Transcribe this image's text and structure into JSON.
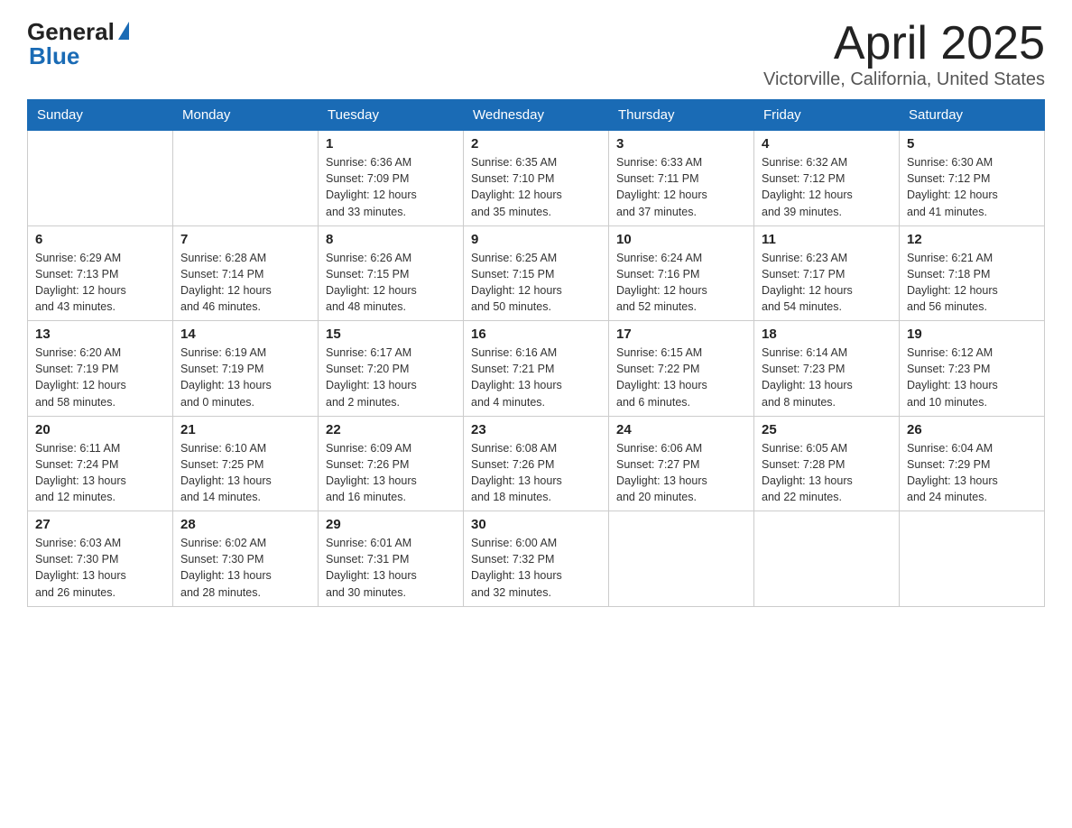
{
  "header": {
    "logo_general": "General",
    "logo_blue": "Blue",
    "title": "April 2025",
    "subtitle": "Victorville, California, United States"
  },
  "weekdays": [
    "Sunday",
    "Monday",
    "Tuesday",
    "Wednesday",
    "Thursday",
    "Friday",
    "Saturday"
  ],
  "weeks": [
    [
      {
        "day": "",
        "info": ""
      },
      {
        "day": "",
        "info": ""
      },
      {
        "day": "1",
        "info": "Sunrise: 6:36 AM\nSunset: 7:09 PM\nDaylight: 12 hours\nand 33 minutes."
      },
      {
        "day": "2",
        "info": "Sunrise: 6:35 AM\nSunset: 7:10 PM\nDaylight: 12 hours\nand 35 minutes."
      },
      {
        "day": "3",
        "info": "Sunrise: 6:33 AM\nSunset: 7:11 PM\nDaylight: 12 hours\nand 37 minutes."
      },
      {
        "day": "4",
        "info": "Sunrise: 6:32 AM\nSunset: 7:12 PM\nDaylight: 12 hours\nand 39 minutes."
      },
      {
        "day": "5",
        "info": "Sunrise: 6:30 AM\nSunset: 7:12 PM\nDaylight: 12 hours\nand 41 minutes."
      }
    ],
    [
      {
        "day": "6",
        "info": "Sunrise: 6:29 AM\nSunset: 7:13 PM\nDaylight: 12 hours\nand 43 minutes."
      },
      {
        "day": "7",
        "info": "Sunrise: 6:28 AM\nSunset: 7:14 PM\nDaylight: 12 hours\nand 46 minutes."
      },
      {
        "day": "8",
        "info": "Sunrise: 6:26 AM\nSunset: 7:15 PM\nDaylight: 12 hours\nand 48 minutes."
      },
      {
        "day": "9",
        "info": "Sunrise: 6:25 AM\nSunset: 7:15 PM\nDaylight: 12 hours\nand 50 minutes."
      },
      {
        "day": "10",
        "info": "Sunrise: 6:24 AM\nSunset: 7:16 PM\nDaylight: 12 hours\nand 52 minutes."
      },
      {
        "day": "11",
        "info": "Sunrise: 6:23 AM\nSunset: 7:17 PM\nDaylight: 12 hours\nand 54 minutes."
      },
      {
        "day": "12",
        "info": "Sunrise: 6:21 AM\nSunset: 7:18 PM\nDaylight: 12 hours\nand 56 minutes."
      }
    ],
    [
      {
        "day": "13",
        "info": "Sunrise: 6:20 AM\nSunset: 7:19 PM\nDaylight: 12 hours\nand 58 minutes."
      },
      {
        "day": "14",
        "info": "Sunrise: 6:19 AM\nSunset: 7:19 PM\nDaylight: 13 hours\nand 0 minutes."
      },
      {
        "day": "15",
        "info": "Sunrise: 6:17 AM\nSunset: 7:20 PM\nDaylight: 13 hours\nand 2 minutes."
      },
      {
        "day": "16",
        "info": "Sunrise: 6:16 AM\nSunset: 7:21 PM\nDaylight: 13 hours\nand 4 minutes."
      },
      {
        "day": "17",
        "info": "Sunrise: 6:15 AM\nSunset: 7:22 PM\nDaylight: 13 hours\nand 6 minutes."
      },
      {
        "day": "18",
        "info": "Sunrise: 6:14 AM\nSunset: 7:23 PM\nDaylight: 13 hours\nand 8 minutes."
      },
      {
        "day": "19",
        "info": "Sunrise: 6:12 AM\nSunset: 7:23 PM\nDaylight: 13 hours\nand 10 minutes."
      }
    ],
    [
      {
        "day": "20",
        "info": "Sunrise: 6:11 AM\nSunset: 7:24 PM\nDaylight: 13 hours\nand 12 minutes."
      },
      {
        "day": "21",
        "info": "Sunrise: 6:10 AM\nSunset: 7:25 PM\nDaylight: 13 hours\nand 14 minutes."
      },
      {
        "day": "22",
        "info": "Sunrise: 6:09 AM\nSunset: 7:26 PM\nDaylight: 13 hours\nand 16 minutes."
      },
      {
        "day": "23",
        "info": "Sunrise: 6:08 AM\nSunset: 7:26 PM\nDaylight: 13 hours\nand 18 minutes."
      },
      {
        "day": "24",
        "info": "Sunrise: 6:06 AM\nSunset: 7:27 PM\nDaylight: 13 hours\nand 20 minutes."
      },
      {
        "day": "25",
        "info": "Sunrise: 6:05 AM\nSunset: 7:28 PM\nDaylight: 13 hours\nand 22 minutes."
      },
      {
        "day": "26",
        "info": "Sunrise: 6:04 AM\nSunset: 7:29 PM\nDaylight: 13 hours\nand 24 minutes."
      }
    ],
    [
      {
        "day": "27",
        "info": "Sunrise: 6:03 AM\nSunset: 7:30 PM\nDaylight: 13 hours\nand 26 minutes."
      },
      {
        "day": "28",
        "info": "Sunrise: 6:02 AM\nSunset: 7:30 PM\nDaylight: 13 hours\nand 28 minutes."
      },
      {
        "day": "29",
        "info": "Sunrise: 6:01 AM\nSunset: 7:31 PM\nDaylight: 13 hours\nand 30 minutes."
      },
      {
        "day": "30",
        "info": "Sunrise: 6:00 AM\nSunset: 7:32 PM\nDaylight: 13 hours\nand 32 minutes."
      },
      {
        "day": "",
        "info": ""
      },
      {
        "day": "",
        "info": ""
      },
      {
        "day": "",
        "info": ""
      }
    ]
  ]
}
